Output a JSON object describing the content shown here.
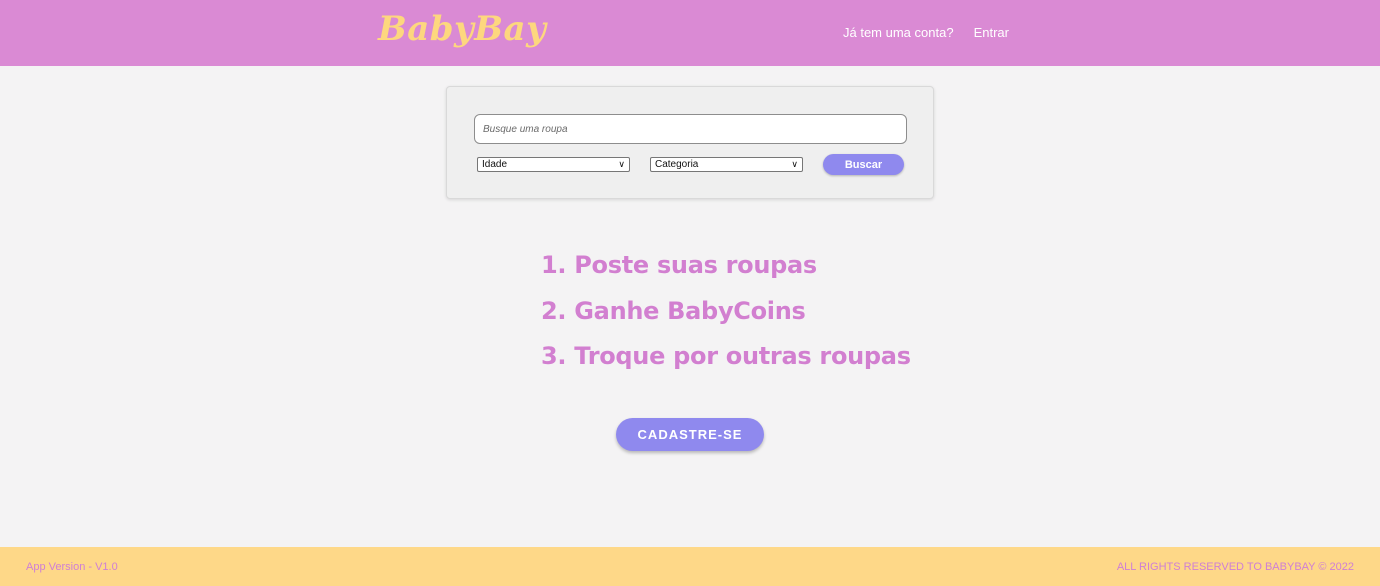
{
  "header": {
    "logo": "BabyBay",
    "nav": {
      "has_account": "Já tem uma conta?",
      "login": "Entrar"
    }
  },
  "search": {
    "placeholder": "Busque uma roupa",
    "age_select": {
      "selected": "Idade"
    },
    "category_select": {
      "selected": "Categoria"
    },
    "button_label": "Buscar"
  },
  "steps": [
    "1. Poste suas roupas",
    "2. Ganhe BabyCoins",
    "3. Troque por outras roupas"
  ],
  "cta": {
    "label": "CADASTRE-SE"
  },
  "footer": {
    "version": "App Version - V1.0",
    "rights": "ALL RIGHTS RESERVED TO BABYBAY © 2022"
  },
  "colors": {
    "header_bg": "#da8ad4",
    "logo": "#fdd77e",
    "accent_button": "#8f89ee",
    "step_text": "#d27fd0",
    "footer_bg": "#fed888",
    "footer_text": "#cf7fd5",
    "page_bg": "#f4f3f4"
  },
  "icons": {
    "select_chevron": "chevron-down-icon"
  }
}
